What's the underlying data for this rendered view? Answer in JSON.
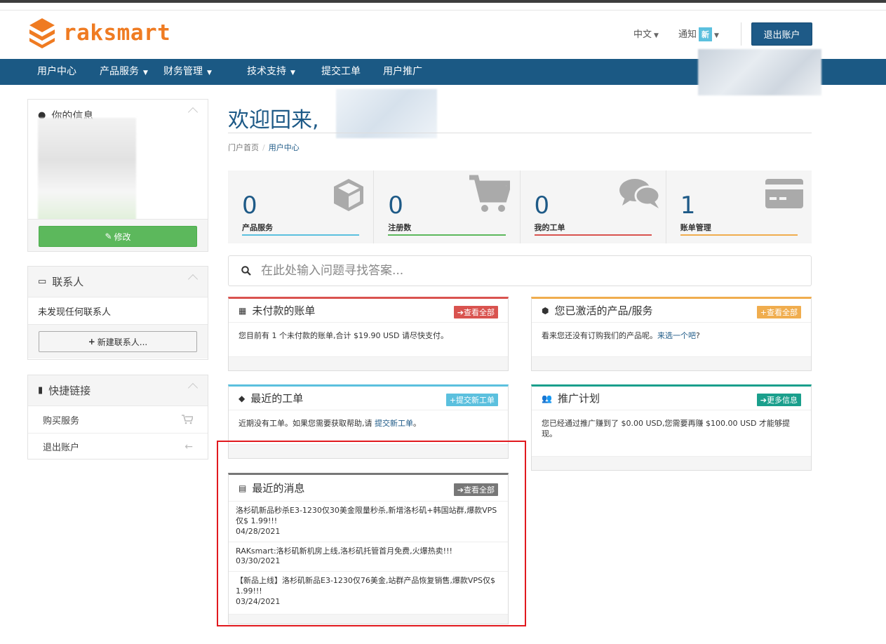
{
  "header": {
    "brand": "raksmart",
    "language": "中文",
    "notifications_label": "通知",
    "notifications_badge": "新",
    "logout_button": "退出账户"
  },
  "nav": {
    "items": [
      {
        "label": "用户中心",
        "dropdown": false
      },
      {
        "label": "产品服务",
        "dropdown": true
      },
      {
        "label": "财务管理",
        "dropdown": true
      },
      {
        "label": "技术支持",
        "dropdown": true
      },
      {
        "label": "提交工单",
        "dropdown": false
      },
      {
        "label": "用户推广",
        "dropdown": false
      }
    ]
  },
  "sidebar": {
    "info": {
      "title": "你的信息",
      "edit_button": "修改"
    },
    "contacts": {
      "title": "联系人",
      "empty_text": "未发现任何联系人",
      "new_button": "新建联系人..."
    },
    "shortcuts": {
      "title": "快捷链接",
      "items": [
        {
          "label": "购买服务",
          "icon": "cart-icon"
        },
        {
          "label": "退出账户",
          "icon": "arrow-left-icon"
        }
      ]
    }
  },
  "main": {
    "welcome": "欢迎回来,",
    "breadcrumb": {
      "home": "门户首页",
      "current": "用户中心"
    },
    "stats": [
      {
        "value": "0",
        "label": "产品服务",
        "color": "#5bc0de",
        "icon": "cube-icon"
      },
      {
        "value": "0",
        "label": "注册数",
        "color": "#5cb85c",
        "icon": "cart-icon"
      },
      {
        "value": "0",
        "label": "我的工单",
        "color": "#d9534f",
        "icon": "comments-icon"
      },
      {
        "value": "1",
        "label": "账单管理",
        "color": "#f0ad4e",
        "icon": "credit-card-icon"
      }
    ],
    "search_placeholder": "在此处输入问题寻找答案...",
    "unpaid": {
      "title": "未付款的账单",
      "button": "查看全部",
      "color": "#d9534f",
      "text": "您目前有 1 个未付款的账单,合计 $19.90 USD 请尽快支付。"
    },
    "active_products": {
      "title": "您已激活的产品/服务",
      "button": "查看全部",
      "color": "#f0ad4e",
      "text_before": "看来您还没有订购我们的产品呢。",
      "link": "来选一个吧",
      "text_after": "?"
    },
    "tickets": {
      "title": "最近的工单",
      "button": "提交新工单",
      "color": "#5bc0de",
      "text_before": "近期没有工单。如果您需要获取帮助,请 ",
      "link": "提交新工单",
      "text_after": "。"
    },
    "affiliate": {
      "title": "推广计划",
      "button": "更多信息",
      "color": "#1a9f8c",
      "text": "您已经通过推广赚到了 $0.00 USD,您需要再赚 $100.00 USD 才能够提现。"
    },
    "news": {
      "title": "最近的消息",
      "button": "查看全部",
      "color": "#777777",
      "items": [
        {
          "text": "洛杉矶新品秒杀E3-1230仅30美金限量秒杀,新增洛杉矶+韩国站群,爆款VPS仅$ 1.99!!!",
          "date": "04/28/2021"
        },
        {
          "text": "RAKsmart:洛杉矶新机房上线,洛杉矶托管首月免费,火爆热卖!!!",
          "date": "03/30/2021"
        },
        {
          "text": "【新品上线】洛杉矶新品E3-1230仅76美金,站群产品恢复销售,爆款VPS仅$ 1.99!!!",
          "date": "03/24/2021"
        }
      ]
    }
  }
}
